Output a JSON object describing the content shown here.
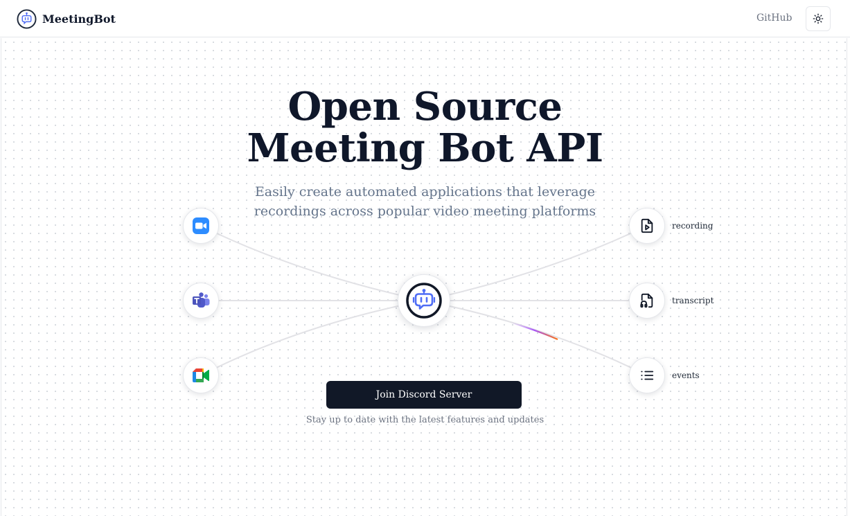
{
  "header": {
    "brand_name": "MeetingBot",
    "github_label": "GitHub"
  },
  "hero": {
    "title_line1": "Open Source",
    "title_line2": "Meeting Bot API",
    "subtitle_line1": "Easily create automated applications that leverage",
    "subtitle_line2": "recordings across popular video meeting platforms"
  },
  "platforms": [
    {
      "icon": "zoom-icon"
    },
    {
      "icon": "microsoft-teams-icon"
    },
    {
      "icon": "google-meet-icon"
    }
  ],
  "outputs": [
    {
      "icon": "file-play-icon",
      "label": "recording"
    },
    {
      "icon": "file-audio-icon",
      "label": "transcript"
    },
    {
      "icon": "list-icon",
      "label": "events"
    }
  ],
  "cta": {
    "button_label": "Join Discord Server",
    "note": "Stay up to date with the latest features and updates"
  },
  "colors": {
    "accent": "#111827",
    "zoom": "#2D8CFF",
    "teams": "#5059C9",
    "bot": "#4F6DF5"
  }
}
